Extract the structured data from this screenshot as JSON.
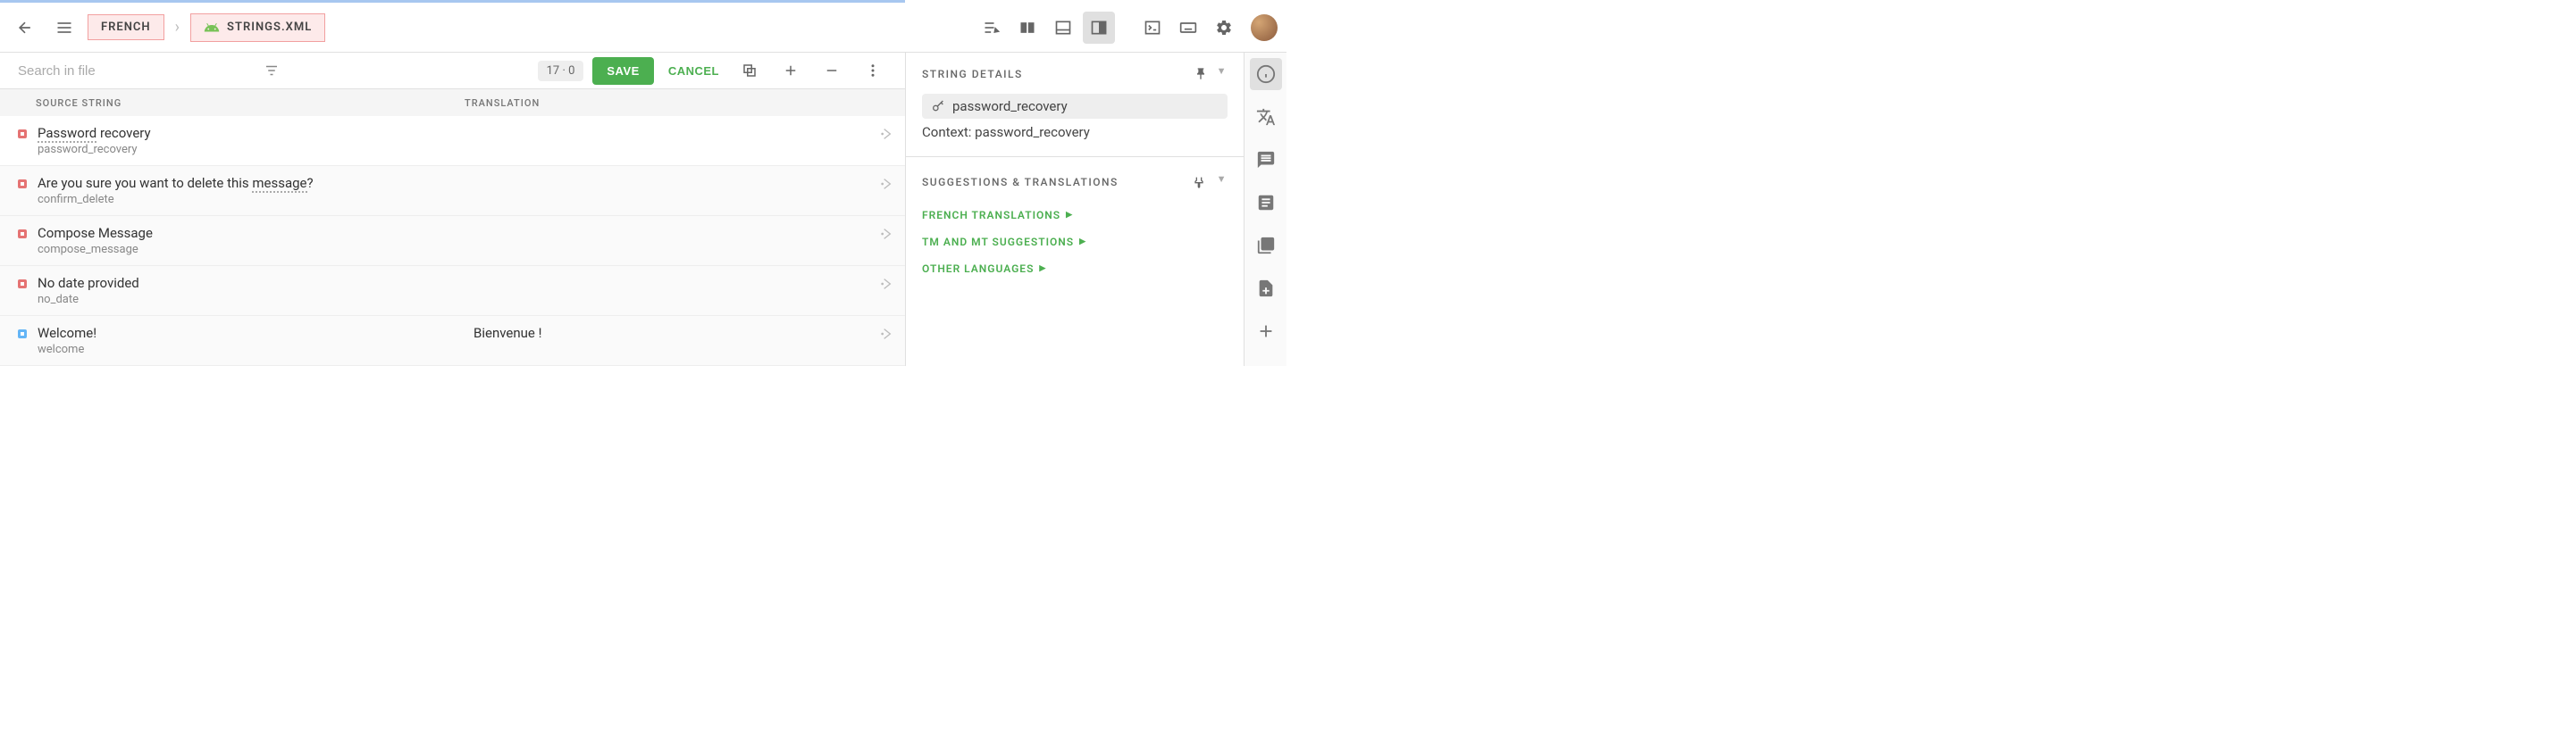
{
  "breadcrumb": {
    "language": "FRENCH",
    "file": "STRINGS.XML"
  },
  "search": {
    "placeholder": "Search in file"
  },
  "toolbar": {
    "count_text": "17 · 0",
    "save_label": "SAVE",
    "cancel_label": "CANCEL"
  },
  "columns": {
    "source": "SOURCE STRING",
    "translation": "TRANSLATION"
  },
  "rows": [
    {
      "status": "red",
      "source_pre": "",
      "source_dotted": "Password",
      "source_post": " recovery",
      "key": "password_recovery",
      "translation": ""
    },
    {
      "status": "red",
      "source_pre": "Are you sure you want to delete this ",
      "source_dotted": "message",
      "source_post": "?",
      "key": "confirm_delete",
      "translation": ""
    },
    {
      "status": "red",
      "source_pre": "Compose Message",
      "source_dotted": "",
      "source_post": "",
      "key": "compose_message",
      "translation": ""
    },
    {
      "status": "red",
      "source_pre": "No date provided",
      "source_dotted": "",
      "source_post": "",
      "key": "no_date",
      "translation": ""
    },
    {
      "status": "blue",
      "source_pre": "Welcome!",
      "source_dotted": "",
      "source_post": "",
      "key": "welcome",
      "translation": "Bienvenue !"
    }
  ],
  "details": {
    "title": "STRING DETAILS",
    "key": "password_recovery",
    "context_label": "Context: ",
    "context_value": "password_recovery"
  },
  "suggestions": {
    "title": "SUGGESTIONS & TRANSLATIONS",
    "links": [
      "FRENCH TRANSLATIONS",
      "TM AND MT SUGGESTIONS",
      "OTHER LANGUAGES"
    ]
  }
}
